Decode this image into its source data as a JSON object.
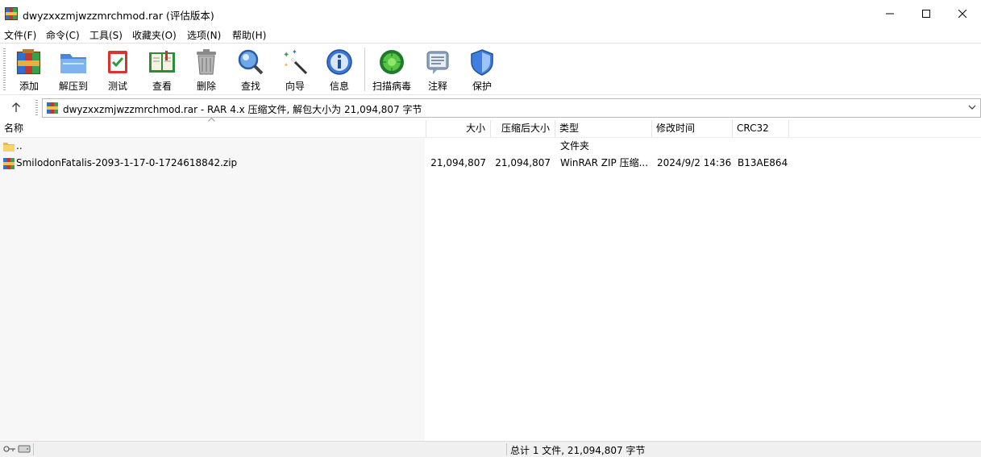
{
  "window": {
    "title": "dwyzxxzmjwzzmrchmod.rar (评估版本)"
  },
  "menu": [
    "文件(F)",
    "命令(C)",
    "工具(S)",
    "收藏夹(O)",
    "选项(N)",
    "帮助(H)"
  ],
  "toolbar": {
    "add": "添加",
    "extract": "解压到",
    "test": "测试",
    "view": "查看",
    "delete": "删除",
    "find": "查找",
    "wizard": "向导",
    "info": "信息",
    "virus_scan": "扫描病毒",
    "comment": "注释",
    "protect": "保护"
  },
  "address": {
    "text": "dwyzxxzmjwzzmrchmod.rar - RAR 4.x 压缩文件, 解包大小为 21,094,807 字节"
  },
  "columns": {
    "name": "名称",
    "size": "大小",
    "packed": "压缩后大小",
    "type": "类型",
    "modified": "修改时间",
    "crc": "CRC32"
  },
  "rows": [
    {
      "name": "..",
      "size": "",
      "packed": "",
      "type": "文件夹",
      "modified": "",
      "crc": ""
    },
    {
      "name": "SmilodonFatalis-2093-1-17-0-1724618842.zip",
      "size": "21,094,807",
      "packed": "21,094,807",
      "type": "WinRAR ZIP 压缩...",
      "modified": "2024/9/2 14:36",
      "crc": "B13AE864"
    }
  ],
  "status": {
    "text": "总计 1 文件, 21,094,807 字节"
  },
  "icons": {
    "app": "winrar-icon",
    "up": "up-arrow-icon",
    "folder": "folder-icon",
    "archive": "archive-icon",
    "lock": "key-icon",
    "drive": "drive-icon"
  },
  "colors": {
    "accent": "#0f2d5a",
    "status_bg": "#f0f0f0"
  }
}
